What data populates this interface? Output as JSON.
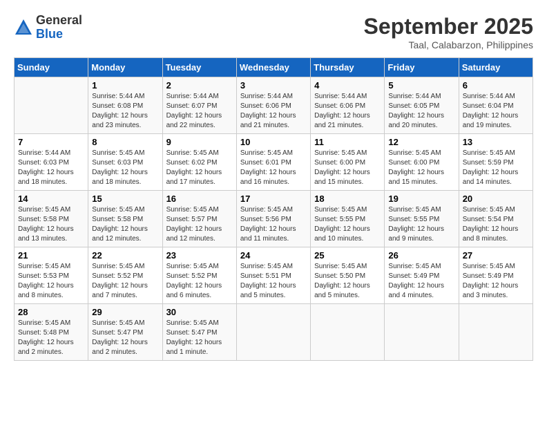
{
  "header": {
    "logo_general": "General",
    "logo_blue": "Blue",
    "month_title": "September 2025",
    "location": "Taal, Calabarzon, Philippines"
  },
  "days_of_week": [
    "Sunday",
    "Monday",
    "Tuesday",
    "Wednesday",
    "Thursday",
    "Friday",
    "Saturday"
  ],
  "weeks": [
    [
      {
        "day": "",
        "info": ""
      },
      {
        "day": "1",
        "info": "Sunrise: 5:44 AM\nSunset: 6:08 PM\nDaylight: 12 hours\nand 23 minutes."
      },
      {
        "day": "2",
        "info": "Sunrise: 5:44 AM\nSunset: 6:07 PM\nDaylight: 12 hours\nand 22 minutes."
      },
      {
        "day": "3",
        "info": "Sunrise: 5:44 AM\nSunset: 6:06 PM\nDaylight: 12 hours\nand 21 minutes."
      },
      {
        "day": "4",
        "info": "Sunrise: 5:44 AM\nSunset: 6:06 PM\nDaylight: 12 hours\nand 21 minutes."
      },
      {
        "day": "5",
        "info": "Sunrise: 5:44 AM\nSunset: 6:05 PM\nDaylight: 12 hours\nand 20 minutes."
      },
      {
        "day": "6",
        "info": "Sunrise: 5:44 AM\nSunset: 6:04 PM\nDaylight: 12 hours\nand 19 minutes."
      }
    ],
    [
      {
        "day": "7",
        "info": "Sunrise: 5:44 AM\nSunset: 6:03 PM\nDaylight: 12 hours\nand 18 minutes."
      },
      {
        "day": "8",
        "info": "Sunrise: 5:45 AM\nSunset: 6:03 PM\nDaylight: 12 hours\nand 18 minutes."
      },
      {
        "day": "9",
        "info": "Sunrise: 5:45 AM\nSunset: 6:02 PM\nDaylight: 12 hours\nand 17 minutes."
      },
      {
        "day": "10",
        "info": "Sunrise: 5:45 AM\nSunset: 6:01 PM\nDaylight: 12 hours\nand 16 minutes."
      },
      {
        "day": "11",
        "info": "Sunrise: 5:45 AM\nSunset: 6:00 PM\nDaylight: 12 hours\nand 15 minutes."
      },
      {
        "day": "12",
        "info": "Sunrise: 5:45 AM\nSunset: 6:00 PM\nDaylight: 12 hours\nand 15 minutes."
      },
      {
        "day": "13",
        "info": "Sunrise: 5:45 AM\nSunset: 5:59 PM\nDaylight: 12 hours\nand 14 minutes."
      }
    ],
    [
      {
        "day": "14",
        "info": "Sunrise: 5:45 AM\nSunset: 5:58 PM\nDaylight: 12 hours\nand 13 minutes."
      },
      {
        "day": "15",
        "info": "Sunrise: 5:45 AM\nSunset: 5:58 PM\nDaylight: 12 hours\nand 12 minutes."
      },
      {
        "day": "16",
        "info": "Sunrise: 5:45 AM\nSunset: 5:57 PM\nDaylight: 12 hours\nand 12 minutes."
      },
      {
        "day": "17",
        "info": "Sunrise: 5:45 AM\nSunset: 5:56 PM\nDaylight: 12 hours\nand 11 minutes."
      },
      {
        "day": "18",
        "info": "Sunrise: 5:45 AM\nSunset: 5:55 PM\nDaylight: 12 hours\nand 10 minutes."
      },
      {
        "day": "19",
        "info": "Sunrise: 5:45 AM\nSunset: 5:55 PM\nDaylight: 12 hours\nand 9 minutes."
      },
      {
        "day": "20",
        "info": "Sunrise: 5:45 AM\nSunset: 5:54 PM\nDaylight: 12 hours\nand 8 minutes."
      }
    ],
    [
      {
        "day": "21",
        "info": "Sunrise: 5:45 AM\nSunset: 5:53 PM\nDaylight: 12 hours\nand 8 minutes."
      },
      {
        "day": "22",
        "info": "Sunrise: 5:45 AM\nSunset: 5:52 PM\nDaylight: 12 hours\nand 7 minutes."
      },
      {
        "day": "23",
        "info": "Sunrise: 5:45 AM\nSunset: 5:52 PM\nDaylight: 12 hours\nand 6 minutes."
      },
      {
        "day": "24",
        "info": "Sunrise: 5:45 AM\nSunset: 5:51 PM\nDaylight: 12 hours\nand 5 minutes."
      },
      {
        "day": "25",
        "info": "Sunrise: 5:45 AM\nSunset: 5:50 PM\nDaylight: 12 hours\nand 5 minutes."
      },
      {
        "day": "26",
        "info": "Sunrise: 5:45 AM\nSunset: 5:49 PM\nDaylight: 12 hours\nand 4 minutes."
      },
      {
        "day": "27",
        "info": "Sunrise: 5:45 AM\nSunset: 5:49 PM\nDaylight: 12 hours\nand 3 minutes."
      }
    ],
    [
      {
        "day": "28",
        "info": "Sunrise: 5:45 AM\nSunset: 5:48 PM\nDaylight: 12 hours\nand 2 minutes."
      },
      {
        "day": "29",
        "info": "Sunrise: 5:45 AM\nSunset: 5:47 PM\nDaylight: 12 hours\nand 2 minutes."
      },
      {
        "day": "30",
        "info": "Sunrise: 5:45 AM\nSunset: 5:47 PM\nDaylight: 12 hours\nand 1 minute."
      },
      {
        "day": "",
        "info": ""
      },
      {
        "day": "",
        "info": ""
      },
      {
        "day": "",
        "info": ""
      },
      {
        "day": "",
        "info": ""
      }
    ]
  ]
}
